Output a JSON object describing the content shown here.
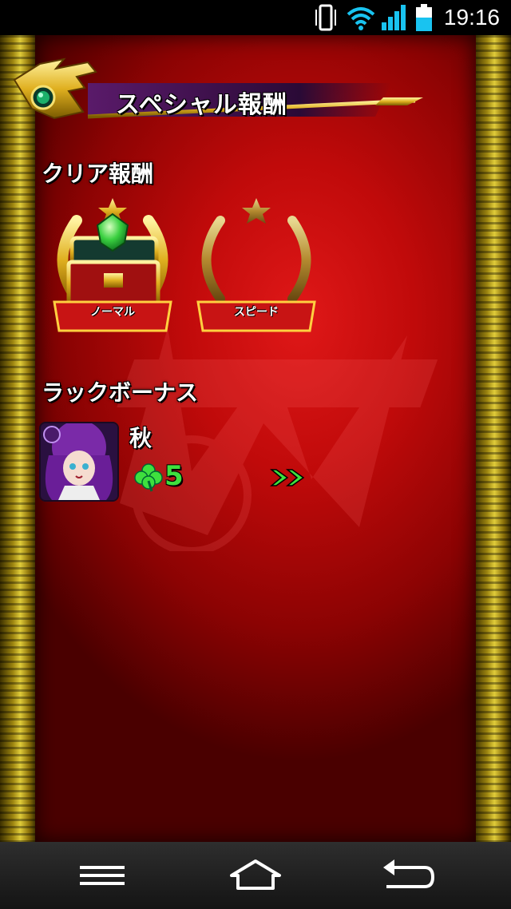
{
  "status_bar": {
    "time": "19:16",
    "icons": [
      "vibrate-icon",
      "wifi-icon",
      "signal-icon",
      "battery-icon"
    ]
  },
  "header": {
    "title": "スペシャル報酬"
  },
  "clear_reward": {
    "heading": "クリア報酬",
    "medals": [
      {
        "label": "ノーマル",
        "achieved": true,
        "icon": "treasure-chest-icon"
      },
      {
        "label": "スピード",
        "achieved": false,
        "icon": "empty-laurel-icon"
      }
    ]
  },
  "luck_bonus": {
    "heading": "ラックボーナス",
    "monster_name": "秋",
    "luck": "5",
    "icon": "clover-icon"
  },
  "nav_bar": {
    "buttons": [
      "menu-icon",
      "home-icon",
      "back-icon"
    ]
  },
  "colors": {
    "panel_red": "#c00a0a",
    "gold": "#e0c030",
    "luck_green": "#3ee03e"
  }
}
